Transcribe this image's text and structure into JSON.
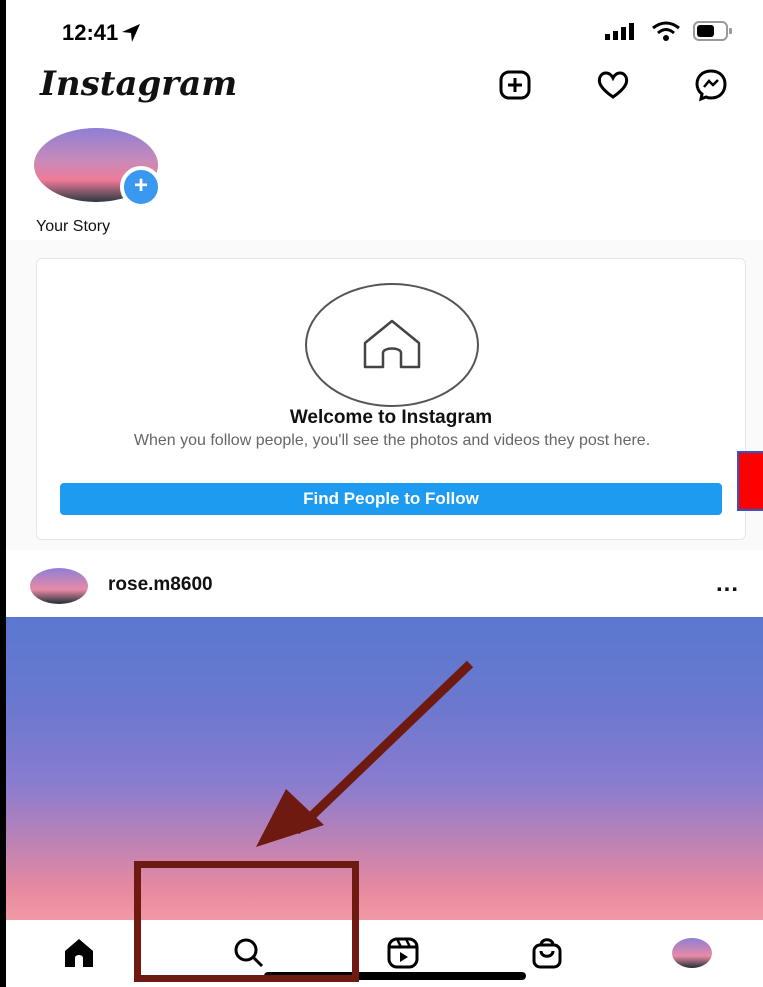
{
  "status_bar": {
    "time": "12:41"
  },
  "header": {
    "logo": "Instagram",
    "icons": [
      "plus-square-icon",
      "heart-icon",
      "messenger-icon"
    ]
  },
  "stories": {
    "your_story_label": "Your Story"
  },
  "welcome": {
    "title": "Welcome to Instagram",
    "text": "When you follow people, you'll see the photos and videos they post here.",
    "button_label": "Find People to Follow"
  },
  "post": {
    "username": "rose.m8600",
    "more_label": "..."
  },
  "tabbar": {
    "tabs": [
      "home-icon",
      "search-icon",
      "reels-icon",
      "shop-icon",
      "profile-avatar"
    ]
  },
  "colors": {
    "accent_blue": "#1d9bf0",
    "annotation": "#6e1a10",
    "red_marker": "#ff0000"
  }
}
